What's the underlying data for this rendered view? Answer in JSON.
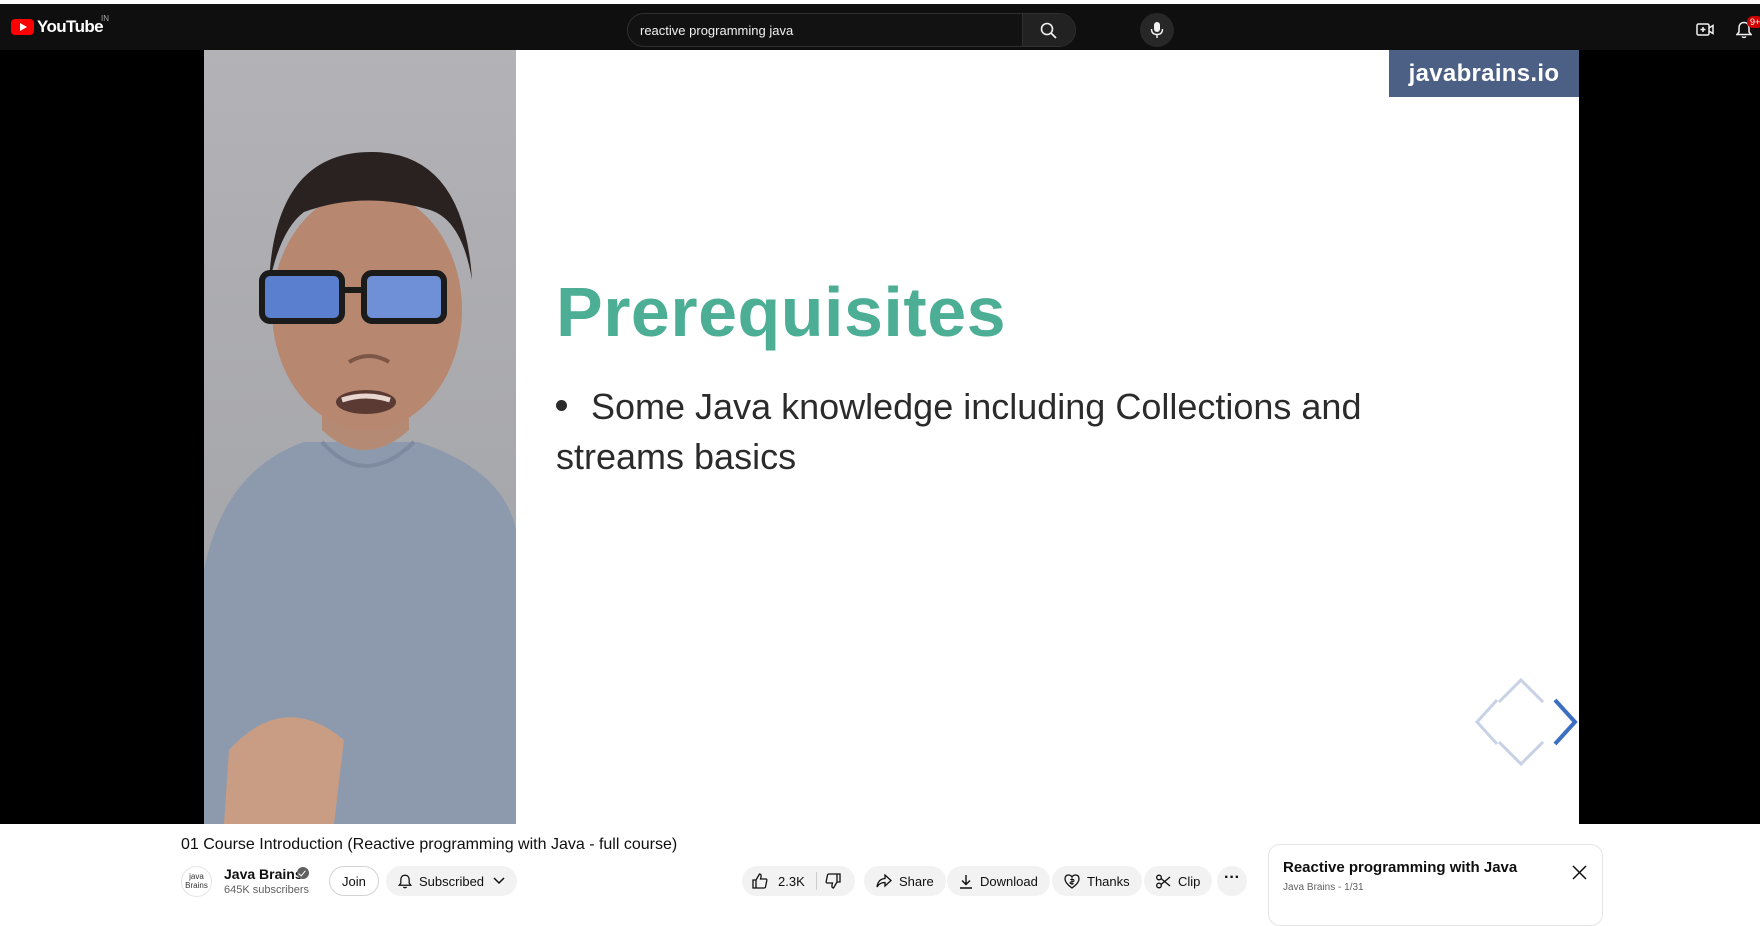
{
  "header": {
    "logo_text": "YouTube",
    "country_code": "IN",
    "search_value": "reactive programming java",
    "notification_count": "9+"
  },
  "video": {
    "watermark": "javabrains.io",
    "slide_title": "Prerequisites",
    "slide_bullet": "Some Java knowledge including Collections and streams basics"
  },
  "details": {
    "title": "01 Course Introduction (Reactive programming with Java - full course)",
    "channel_avatar_text": "java Brains",
    "channel_name": "Java Brains",
    "subscribers": "645K subscribers",
    "join_label": "Join",
    "subscribed_label": "Subscribed",
    "like_count": "2.3K",
    "share_label": "Share",
    "download_label": "Download",
    "thanks_label": "Thanks",
    "clip_label": "Clip",
    "more_label": "···"
  },
  "playlist": {
    "title": "Reactive programming with Java",
    "subtitle": "Java Brains - 1/31"
  },
  "icons": {
    "clear": "close-icon",
    "search": "search-icon",
    "mic": "mic-icon",
    "create": "create-video-icon",
    "notifications": "bell-icon",
    "like": "thumbs-up-icon",
    "dislike": "thumbs-down-icon",
    "share": "share-icon",
    "download": "download-icon",
    "thanks": "thanks-icon",
    "clip": "scissors-icon"
  },
  "colors": {
    "masthead": "#0f0f0f",
    "brand_red": "#ff0000",
    "slide_title": "#4cae94",
    "watermark_bg": "#4c5f85",
    "pill_bg": "#f2f2f2"
  }
}
